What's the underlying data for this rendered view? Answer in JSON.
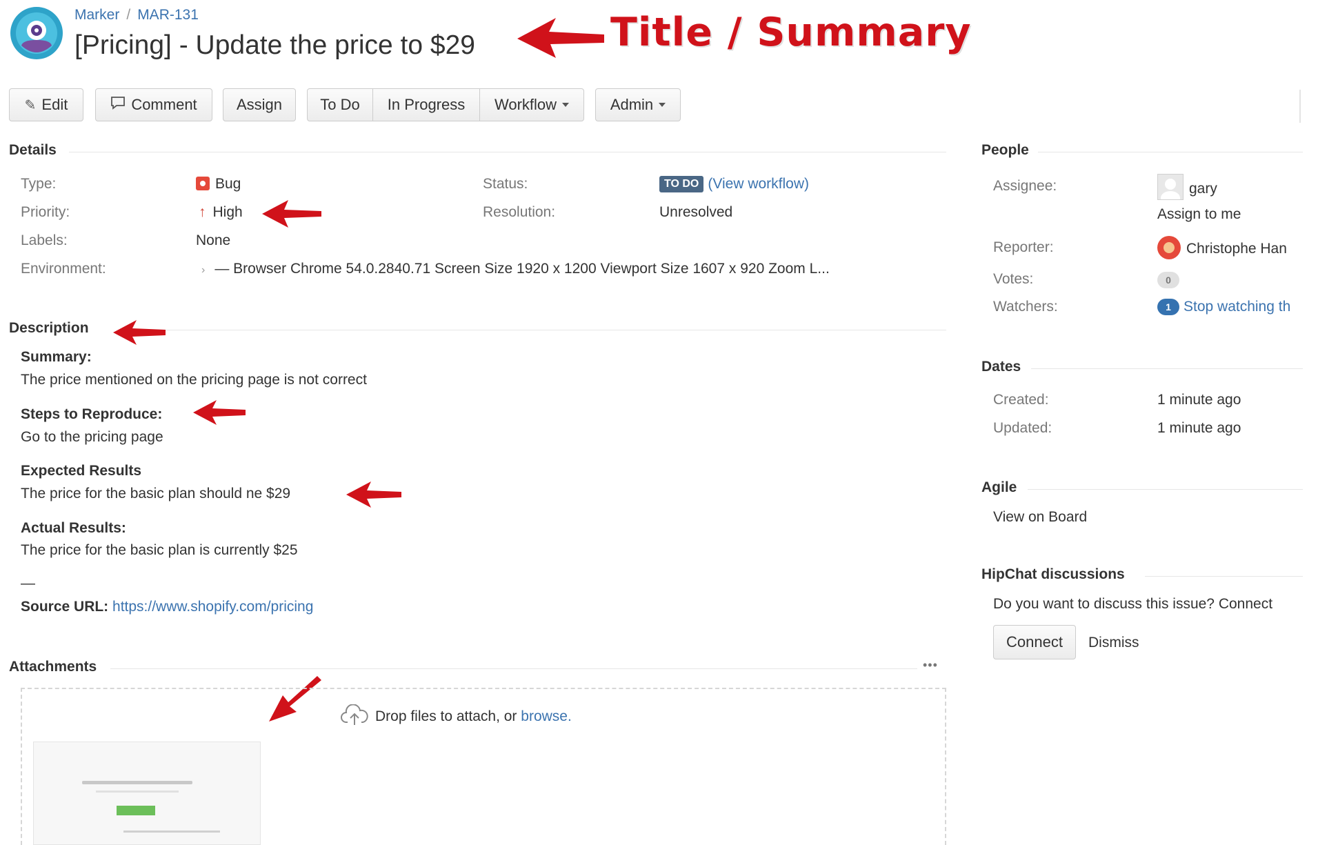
{
  "header": {
    "breadcrumb_project": "Marker",
    "breadcrumb_sep": "/",
    "breadcrumb_issue": "MAR-131",
    "title": "[Pricing] - Update the price to $29"
  },
  "annotations": {
    "title_summary": "Title / Summary"
  },
  "toolbar": {
    "edit": "Edit",
    "comment": "Comment",
    "assign": "Assign",
    "todo": "To Do",
    "in_progress": "In Progress",
    "workflow": "Workflow",
    "admin": "Admin"
  },
  "details": {
    "heading": "Details",
    "type_label": "Type:",
    "type_value": "Bug",
    "priority_label": "Priority:",
    "priority_value": "High",
    "labels_label": "Labels:",
    "labels_value": "None",
    "environment_label": "Environment:",
    "environment_value": "— Browser Chrome 54.0.2840.71 Screen Size 1920 x 1200 Viewport Size 1607 x 920 Zoom L...",
    "status_label": "Status:",
    "status_value": "TO DO",
    "status_link": "(View workflow)",
    "resolution_label": "Resolution:",
    "resolution_value": "Unresolved"
  },
  "description": {
    "heading": "Description",
    "summary_label": "Summary:",
    "summary_text": "The price mentioned on the pricing page is not correct",
    "steps_label": "Steps to Reproduce:",
    "steps_text": "Go to the pricing page",
    "expected_label": "Expected Results",
    "expected_text": "The price for the basic plan should ne $29",
    "actual_label": "Actual Results:",
    "actual_text": "The price for the basic plan is currently $25",
    "divider": "—",
    "source_label": "Source URL:",
    "source_url": "https://www.shopify.com/pricing"
  },
  "attachments": {
    "heading": "Attachments",
    "more": "•••",
    "drop_text": "Drop files to attach, or",
    "browse": "browse."
  },
  "people": {
    "heading": "People",
    "assignee_label": "Assignee:",
    "assignee_value": "gary",
    "assign_to_me": "Assign to me",
    "reporter_label": "Reporter:",
    "reporter_value": "Christophe Han",
    "votes_label": "Votes:",
    "votes_count": "0",
    "watchers_label": "Watchers:",
    "watchers_count": "1",
    "watch_link": "Stop watching th"
  },
  "dates": {
    "heading": "Dates",
    "created_label": "Created:",
    "created_value": "1 minute ago",
    "updated_label": "Updated:",
    "updated_value": "1 minute ago"
  },
  "agile": {
    "heading": "Agile",
    "board_link": "View on Board"
  },
  "hipchat": {
    "heading": "HipChat discussions",
    "prompt": "Do you want to discuss this issue? Connect",
    "connect": "Connect",
    "dismiss": "Dismiss"
  },
  "colors": {
    "link": "#3b73af",
    "annotation_red": "#d0121a",
    "status_lozenge": "#4a6785",
    "bug_red": "#e5493a"
  }
}
